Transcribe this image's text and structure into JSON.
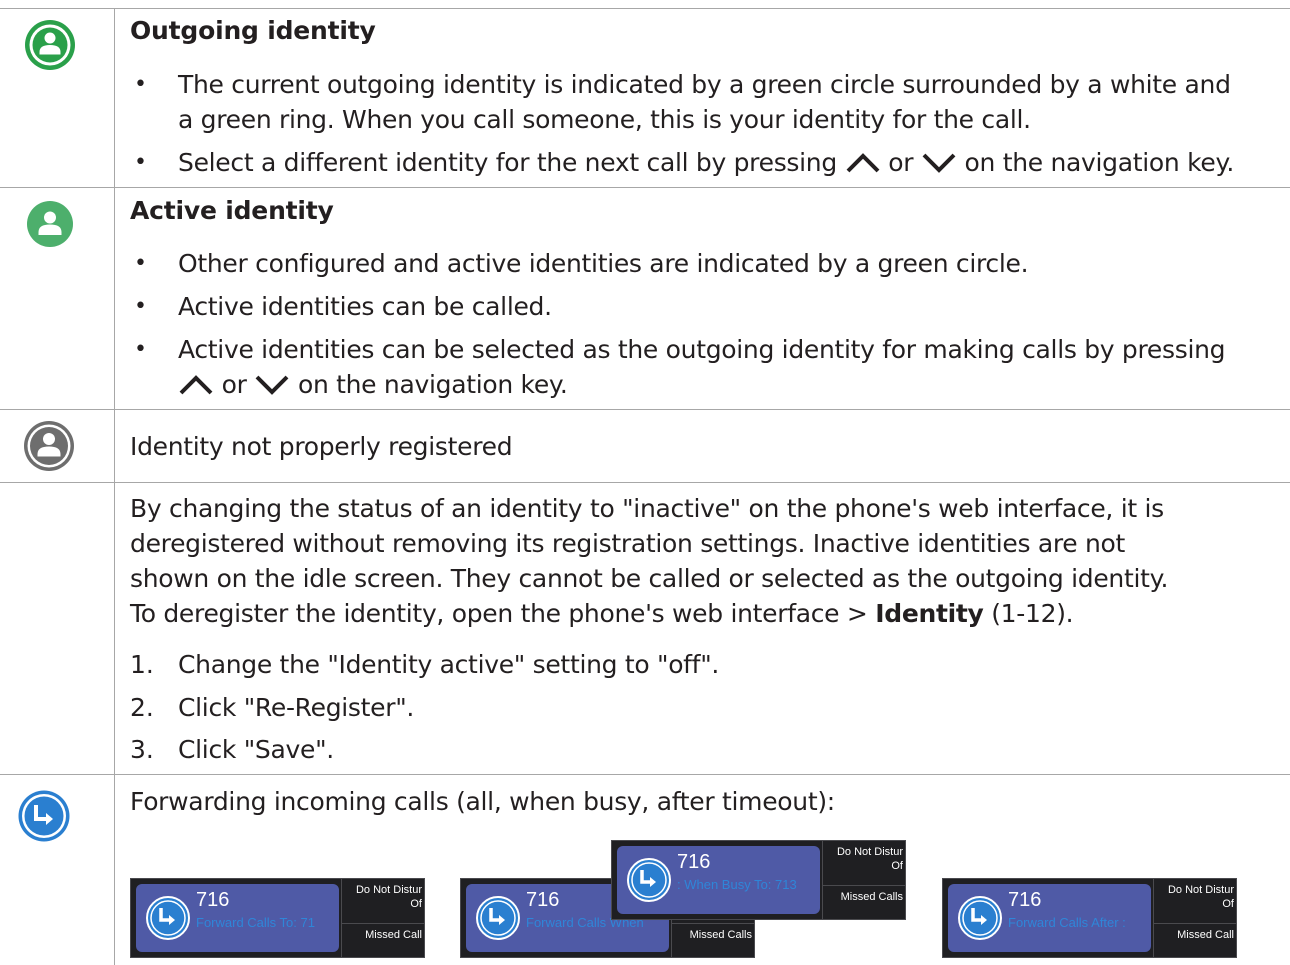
{
  "colors": {
    "green": "#2aa04a",
    "green_light": "#4daf6c",
    "grey": "#6e6e6e",
    "blue": "#2a7fd0",
    "tile": "#4f5aa6"
  },
  "rows": {
    "outgoing": {
      "icon": "outgoing-identity-icon",
      "heading": "Outgoing identity",
      "b1_l1": "The current outgoing identity is indicated by a green circle surrounded by a white and",
      "b1_l2": "a green ring. When you call someone, this is your identity for the call.",
      "b2_pre": "Select a different identity for the next call by pressing",
      "or": "or",
      "b2_post": "on the navigation key."
    },
    "active": {
      "icon": "active-identity-icon",
      "heading": "Active identity",
      "b1": "Other configured and active identities are indicated by a green circle.",
      "b2": "Active identities can be called.",
      "b3_l1": "Active identities can be selected as the outgoing identity for making calls by pressing",
      "or": "or",
      "b3_post": "on the navigation key."
    },
    "not_registered": {
      "icon": "unregistered-identity-icon",
      "text": "Identity not properly registered"
    },
    "inactive": {
      "p_l1": "By changing the status of an identity to \"inactive\" on the phone's web interface, it is",
      "p_l2": "deregistered without removing its registration settings.  Inactive identities are not",
      "p_l3": "shown on the idle screen.  They cannot be called or selected as the outgoing identity.",
      "p_l4_pre": "To deregister the identity, open the phone's web interface  >",
      "p_l4_bold": "Identity",
      "p_l4_post": "(1-12).",
      "steps": [
        {
          "n": "1.",
          "t": "Change the \"Identity active\" setting to \"off\"."
        },
        {
          "n": "2.",
          "t": "Click \"Re-Register\"."
        },
        {
          "n": "3.",
          "t": "Click \"Save\"."
        }
      ]
    },
    "forwarding": {
      "icon": "call-forward-icon",
      "text": "Forwarding incoming calls (all, when busy, after timeout):",
      "screens": [
        {
          "number": "716",
          "sub": "Forward Calls To: 71",
          "dnd": "Do Not Distur",
          "dnd2": "Of",
          "missed": "Missed Call"
        },
        {
          "number": "716",
          "sub": "Forward Calls When",
          "dnd": "",
          "dnd2": "",
          "missed": "Missed Calls"
        },
        {
          "number": "716",
          "sub": ": When Busy To: 713",
          "dnd": "Do Not Distur",
          "dnd2": "Of",
          "missed": "Missed Calls"
        },
        {
          "number": "716",
          "sub": "Forward Calls After :",
          "dnd": "Do Not Distur",
          "dnd2": "Of",
          "missed": "Missed Call"
        }
      ]
    }
  }
}
